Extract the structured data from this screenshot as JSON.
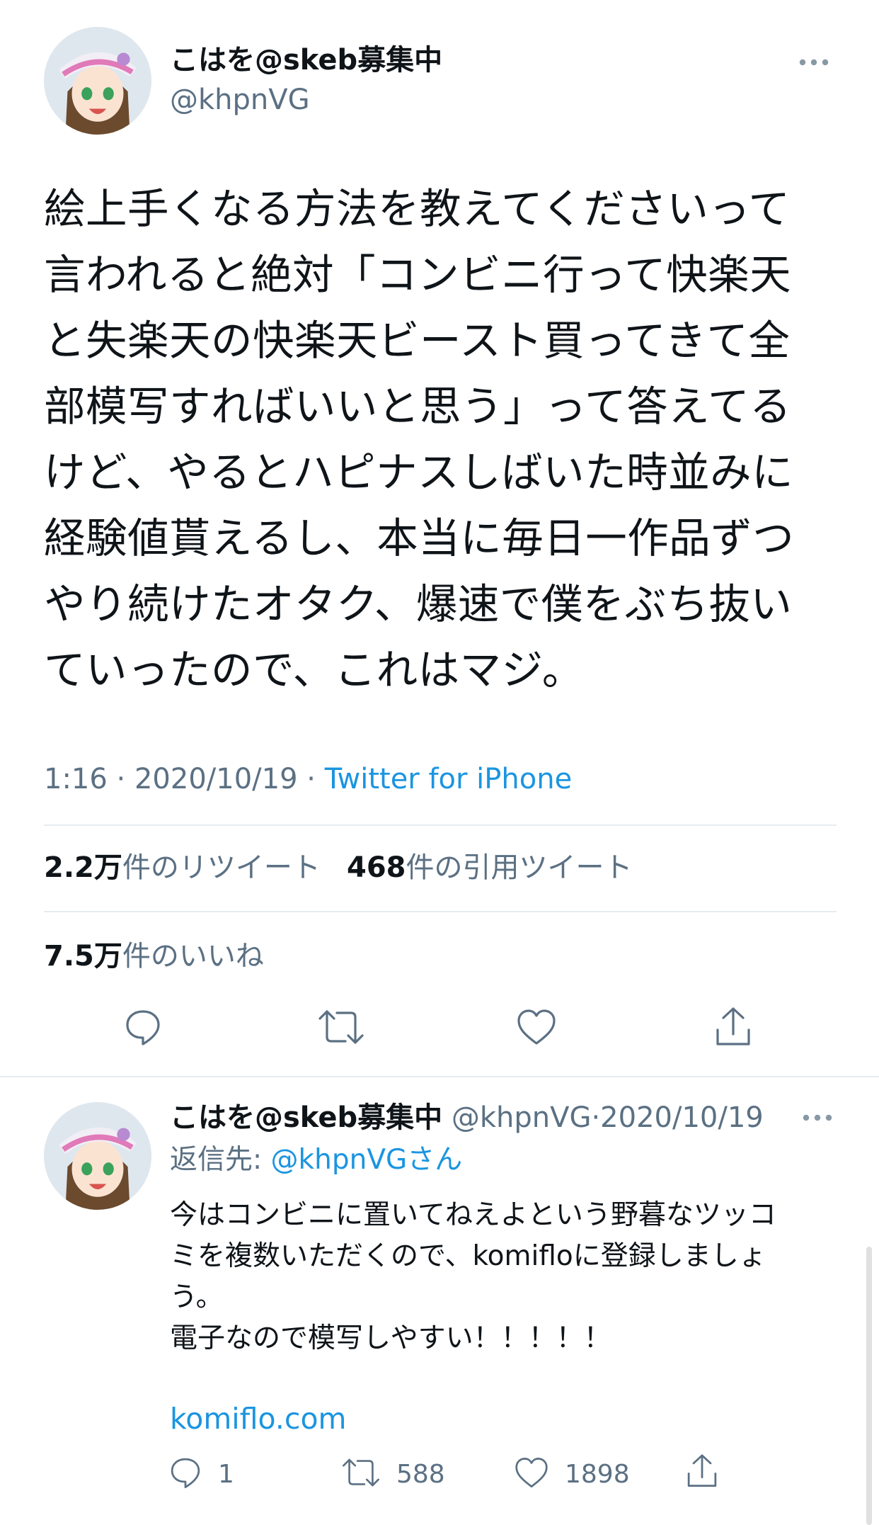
{
  "main_tweet": {
    "display_name": "こはを@skeb募集中",
    "handle": "@khpnVG",
    "text_lines": [
      "絵上手くなる方法を教えてくださいって",
      "言われると絶対「コンビニ行って快楽天",
      "と失楽天の快楽天ビースト買ってきて全",
      "部模写すればいいと思う」って答えてる",
      "けど、やるとハピナスしばいた時並みに",
      "経験値貰えるし、本当に毎日一作品ずつ",
      "やり続けたオタク、爆速で僕をぶち抜い",
      "ていったので、これはマジ。"
    ],
    "time": "1:16",
    "date": "2020/10/19",
    "source": "Twitter for iPhone",
    "separator": "·",
    "retweets_count": "2.2万",
    "retweets_label": "件のリツイート",
    "quotes_count": "468",
    "quotes_label": "件の引用ツイート",
    "likes_count": "7.5万",
    "likes_label": "件のいいね"
  },
  "reply_tweet": {
    "display_name": "こはを@skeb募集中",
    "handle": "@khpnVG",
    "separator": "·",
    "date": "2020/10/19",
    "reply_to_label": "返信先: ",
    "reply_to_handle": "@khpnVGさん",
    "text_lines": [
      "今はコンビニに置いてねえよという野暮なツッコ",
      "ミを複数いただくので、komifloに登録しましょ",
      "う。",
      "電子なので模写しやすい！！！！！"
    ],
    "link": "komiflo.com",
    "reply_count": "1",
    "retweet_count": "588",
    "like_count": "1898"
  },
  "icons": {
    "more": "more-horizontal-icon",
    "reply": "reply-icon",
    "retweet": "retweet-icon",
    "like": "heart-icon",
    "share": "share-icon"
  },
  "colors": {
    "link": "#1b95e0",
    "muted": "#5b7083",
    "divider": "#e6ecf0"
  }
}
